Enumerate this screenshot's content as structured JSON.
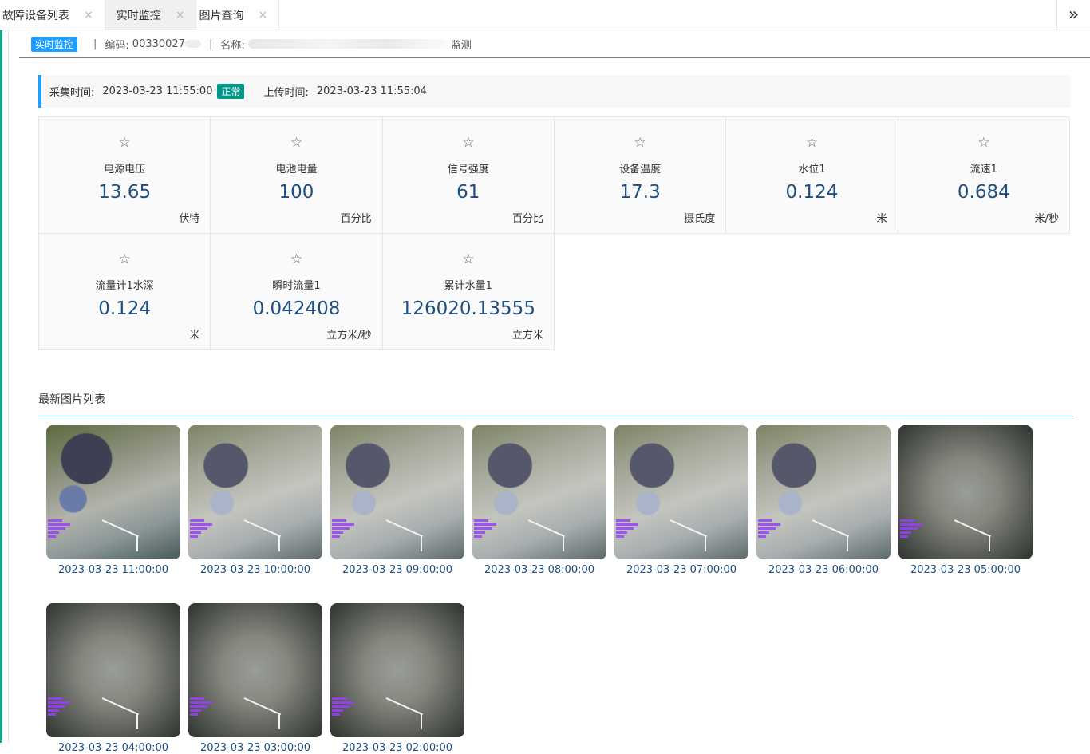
{
  "tabs": [
    {
      "label": "故障设备列表",
      "active": false
    },
    {
      "label": "实时监控",
      "active": true
    },
    {
      "label": "图片查询",
      "active": false
    }
  ],
  "tab_close_glyph": "×",
  "tab_more_icon": "double-chevron-right-icon",
  "tab_more_glyph": "»",
  "breadcrumb": {
    "badge": "实时监控",
    "code_label": "编码:",
    "code_value": "00330027",
    "name_label": "名称:",
    "name_suffix": "监测"
  },
  "timebar": {
    "collect_label": "采集时间:",
    "collect_time": "2023-03-23 11:55:00",
    "status": "正常",
    "upload_label": "上传时间:",
    "upload_time": "2023-03-23 11:55:04"
  },
  "star_glyph": "☆",
  "metrics": [
    {
      "name": "电源电压",
      "value": "13.65",
      "unit": "伏特"
    },
    {
      "name": "电池电量",
      "value": "100",
      "unit": "百分比"
    },
    {
      "name": "信号强度",
      "value": "61",
      "unit": "百分比"
    },
    {
      "name": "设备温度",
      "value": "17.3",
      "unit": "摄氏度"
    },
    {
      "name": "水位1",
      "value": "0.124",
      "unit": "米"
    },
    {
      "name": "流速1",
      "value": "0.684",
      "unit": "米/秒"
    },
    {
      "name": "流量计1水深",
      "value": "0.124",
      "unit": "米"
    },
    {
      "name": "瞬时流量1",
      "value": "0.042408",
      "unit": "立方米/秒"
    },
    {
      "name": "累计水量1",
      "value": "126020.13555",
      "unit": "立方米"
    }
  ],
  "photo_list": {
    "title": "最新图片列表",
    "photos": [
      {
        "time": "2023-03-23 11:00:00",
        "tone": "clear"
      },
      {
        "time": "2023-03-23 10:00:00",
        "tone": "hazy"
      },
      {
        "time": "2023-03-23 09:00:00",
        "tone": "hazy"
      },
      {
        "time": "2023-03-23 08:00:00",
        "tone": "hazy"
      },
      {
        "time": "2023-03-23 07:00:00",
        "tone": "hazy"
      },
      {
        "time": "2023-03-23 06:00:00",
        "tone": "hazy"
      },
      {
        "time": "2023-03-23 05:00:00",
        "tone": "night"
      },
      {
        "time": "2023-03-23 04:00:00",
        "tone": "night"
      },
      {
        "time": "2023-03-23 03:00:00",
        "tone": "night"
      },
      {
        "time": "2023-03-23 02:00:00",
        "tone": "night"
      }
    ]
  }
}
